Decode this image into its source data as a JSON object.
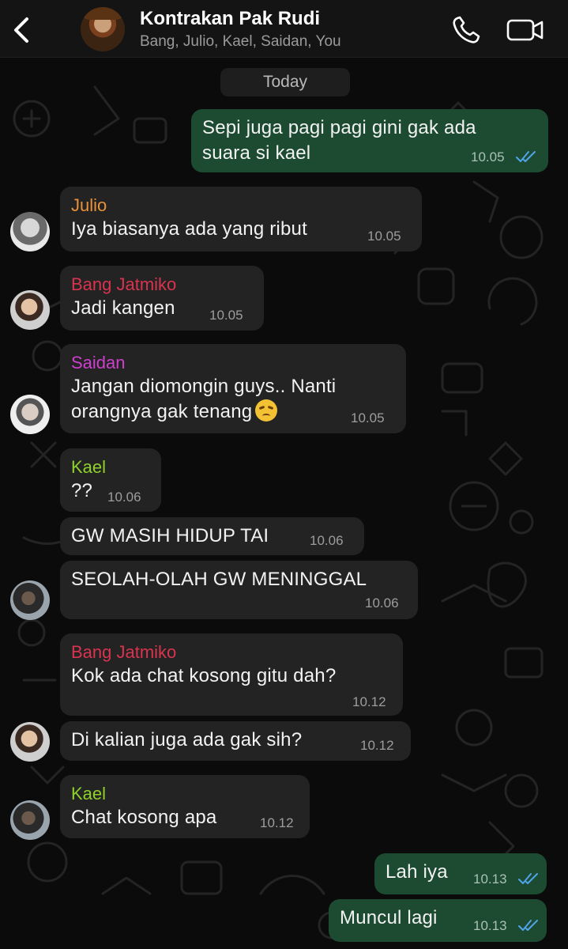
{
  "header": {
    "title": "Kontrakan Pak Rudi",
    "members": "Bang, Julio, Kael, Saidan, You"
  },
  "day_label": "Today",
  "colors": {
    "julio": "#e9903a",
    "bang_jatmiko": "#d9344f",
    "saidan": "#cf3fce",
    "kael": "#8fd12b",
    "outgoing_bubble": "#1d4b32",
    "incoming_bubble": "#232323",
    "read_ticks": "#4fa3e8"
  },
  "messages": [
    {
      "from": "You",
      "lines": [
        "Sepi juga pagi pagi gini gak ada",
        "suara si kael"
      ],
      "time": "10.05",
      "status": "read"
    },
    {
      "from": "Julio",
      "lines": [
        "Iya biasanya ada yang ribut"
      ],
      "time": "10.05"
    },
    {
      "from": "Bang Jatmiko",
      "lines": [
        "Jadi kangen"
      ],
      "time": "10.05"
    },
    {
      "from": "Saidan",
      "lines": [
        "Jangan diomongin guys.. Nanti",
        "orangnya gak tenang"
      ],
      "emoji": "disappointed-face",
      "time": "10.05"
    },
    {
      "from": "Kael",
      "lines": [
        "??"
      ],
      "time": "10.06"
    },
    {
      "from": "Kael",
      "lines": [
        "GW MASIH HIDUP TAI"
      ],
      "time": "10.06"
    },
    {
      "from": "Kael",
      "lines": [
        "SEOLAH-OLAH GW MENINGGAL"
      ],
      "time": "10.06"
    },
    {
      "from": "Bang Jatmiko",
      "lines": [
        "Kok ada chat kosong gitu dah?"
      ],
      "time": "10.12"
    },
    {
      "from": "Bang Jatmiko",
      "lines": [
        "Di kalian juga ada gak sih?"
      ],
      "time": "10.12"
    },
    {
      "from": "Kael",
      "lines": [
        "Chat kosong apa"
      ],
      "time": "10.12"
    },
    {
      "from": "You",
      "lines": [
        "Lah iya"
      ],
      "time": "10.13",
      "status": "read"
    },
    {
      "from": "You",
      "lines": [
        "Muncul lagi"
      ],
      "time": "10.13",
      "status": "read"
    }
  ],
  "senders": {
    "julio": "Julio",
    "bang_jatmiko": "Bang Jatmiko",
    "saidan": "Saidan",
    "kael": "Kael"
  }
}
